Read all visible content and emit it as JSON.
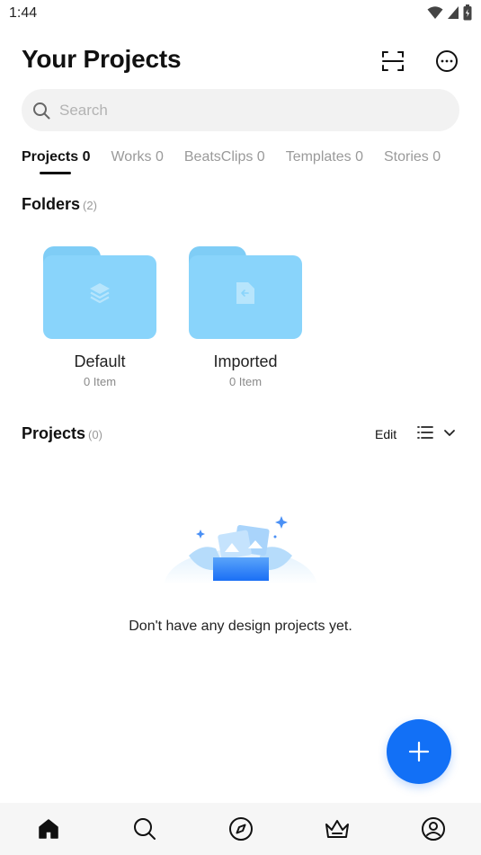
{
  "status_bar": {
    "time": "1:44",
    "icons": [
      "wifi-icon",
      "signal-icon",
      "battery-icon"
    ]
  },
  "header": {
    "title": "Your Projects",
    "scan_icon": "scan-icon",
    "more_icon": "more-icon"
  },
  "search": {
    "placeholder": "Search",
    "value": ""
  },
  "tabs": [
    {
      "label": "Projects 0",
      "active": true
    },
    {
      "label": "Works 0",
      "active": false
    },
    {
      "label": "BeatsClips 0",
      "active": false
    },
    {
      "label": "Templates 0",
      "active": false
    },
    {
      "label": "Stories 0",
      "active": false
    }
  ],
  "folders_section": {
    "title": "Folders",
    "count": "(2)",
    "items": [
      {
        "name": "Default",
        "count": "0 Item",
        "icon": "layers-icon"
      },
      {
        "name": "Imported",
        "count": "0 Item",
        "icon": "import-file-icon"
      }
    ]
  },
  "projects_section": {
    "title": "Projects",
    "count": "(0)",
    "edit_label": "Edit",
    "view_icon": "list-view-icon",
    "empty_text": "Don't have any design projects yet."
  },
  "colors": {
    "accent": "#1270f6",
    "folder": "#89d4fb",
    "search_bg": "#f2f2f2"
  },
  "bottom_nav": [
    {
      "icon": "home-icon",
      "active": true
    },
    {
      "icon": "search-icon",
      "active": false
    },
    {
      "icon": "compass-icon",
      "active": false
    },
    {
      "icon": "crown-icon",
      "active": false
    },
    {
      "icon": "profile-icon",
      "active": false
    }
  ]
}
